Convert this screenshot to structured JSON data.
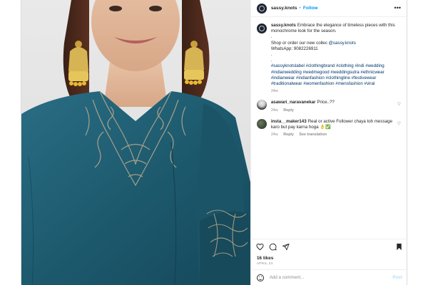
{
  "post": {
    "username": "sassy.knots",
    "separator": "•",
    "follow_label": "Follow",
    "more_icon": "more-horizontal-icon"
  },
  "caption": {
    "username": "sassy.knots",
    "line1": "Embrace the elegance of timeless pieces with this monochrome look for the season.",
    "dot1": ".",
    "line2": "Shop or order our new collec",
    "mention": "@sassy.knots",
    "line3": "WhatsApp: 9082226911",
    "dot2": ".",
    "dot3": ".",
    "hashtags": "#sassyknotslabel #clothingbrand #clothing #indi #wedding #indianwedding #wedmegood #weddingsutra #ethnicwear #indianwear #indianfashion #clothingline #festivewear #traditionalwear #womenfashion #mensfashion #viral",
    "time": "24w"
  },
  "comments": [
    {
      "username": "asawari_naravanekar",
      "text": "Price..??",
      "time": "24w",
      "reply": "Reply"
    },
    {
      "username": "insta__maker143",
      "text": "Real or active Follower chaya toh message karo but pay karna hoga 👌✅",
      "time": "24w",
      "reply": "Reply",
      "translation": "See translation"
    }
  ],
  "actions": {
    "icons": [
      "heart-icon",
      "comment-icon",
      "share-icon",
      "bookmark-icon"
    ]
  },
  "likes": "16 likes",
  "date": "APRIL 23",
  "add_comment": {
    "placeholder": "Add a comment...",
    "post_label": "Post"
  },
  "colors": {
    "link_blue": "#0095f6",
    "hashtag": "#00376b",
    "kurta_teal": "#1f5a6e",
    "embroidery": "#b8a88a",
    "earring_gold": "#c9a13b"
  }
}
